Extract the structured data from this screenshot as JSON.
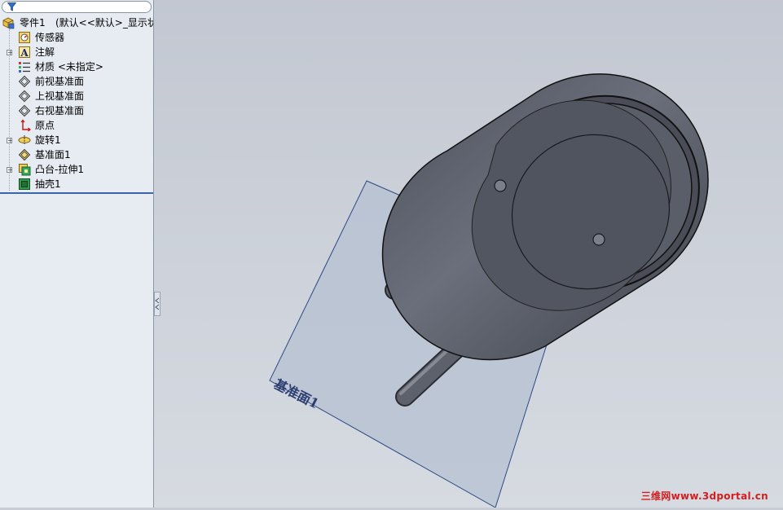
{
  "feature_tree": {
    "root": {
      "label": "零件1",
      "config": "(默认<<默认>_显示状态"
    },
    "items": [
      {
        "label": "传感器",
        "icon": "sensor-icon",
        "expandable": false
      },
      {
        "label": "注解",
        "icon": "annotation-icon",
        "expandable": true
      },
      {
        "label": "材质 <未指定>",
        "icon": "material-icon",
        "expandable": false
      },
      {
        "label": "前视基准面",
        "icon": "plane-icon",
        "expandable": false
      },
      {
        "label": "上视基准面",
        "icon": "plane-icon",
        "expandable": false
      },
      {
        "label": "右视基准面",
        "icon": "plane-icon",
        "expandable": false
      },
      {
        "label": "原点",
        "icon": "origin-icon",
        "expandable": false
      },
      {
        "label": "旋转1",
        "icon": "revolve-icon",
        "expandable": true
      },
      {
        "label": "基准面1",
        "icon": "plane-icon",
        "expandable": false
      },
      {
        "label": "凸台-拉伸1",
        "icon": "extrude-icon",
        "expandable": true
      },
      {
        "label": "抽壳1",
        "icon": "shell-icon",
        "expandable": false
      }
    ]
  },
  "viewport": {
    "plane_label": "基准面1"
  },
  "watermark": "三维网www.3dportal.cn",
  "colors": {
    "viewport_bg": "#c7ccd5",
    "sidebar_bg": "#e7ebf2",
    "model_body": "#5b5f6b",
    "plane_fill": "#b9c3d4",
    "plane_edge": "#2c4a86",
    "selection_line": "#3c64a8",
    "watermark": "#d21e1e"
  }
}
